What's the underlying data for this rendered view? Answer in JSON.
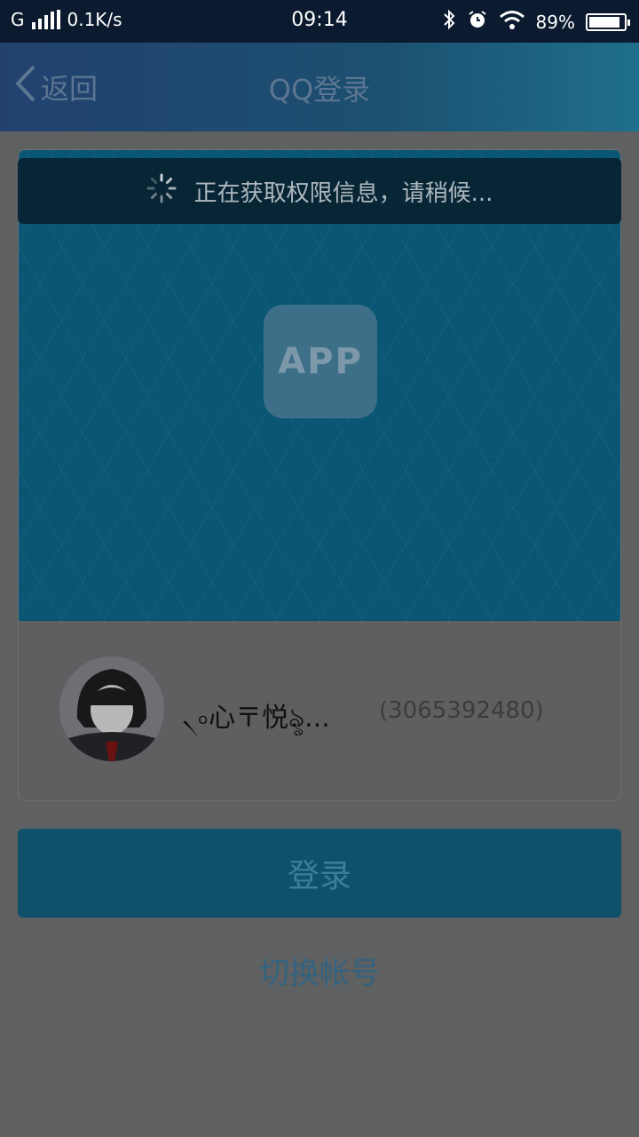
{
  "status_bar": {
    "network": "G",
    "speed": "0.1K/s",
    "time": "09:14",
    "battery": "89%",
    "battery_level": 0.89,
    "icons": [
      "bluetooth-icon",
      "alarm-icon",
      "wifi-icon",
      "battery-icon"
    ]
  },
  "nav": {
    "back_label": "返回",
    "title": "QQ登录"
  },
  "toast": {
    "message": "正在获取权限信息，请稍候..."
  },
  "app": {
    "icon_label": "APP"
  },
  "user": {
    "nickname": "৲৹心〒悦ৡ...",
    "qq_number": "(3065392480)"
  },
  "actions": {
    "login_label": "登录",
    "switch_account_label": "切换帐号"
  },
  "colors": {
    "status_bar": "#0b1a2e",
    "nav_bar": "#22416f",
    "banner": "#0a5675",
    "login_button": "#0f506b",
    "overlay_background": "#5f6062"
  }
}
